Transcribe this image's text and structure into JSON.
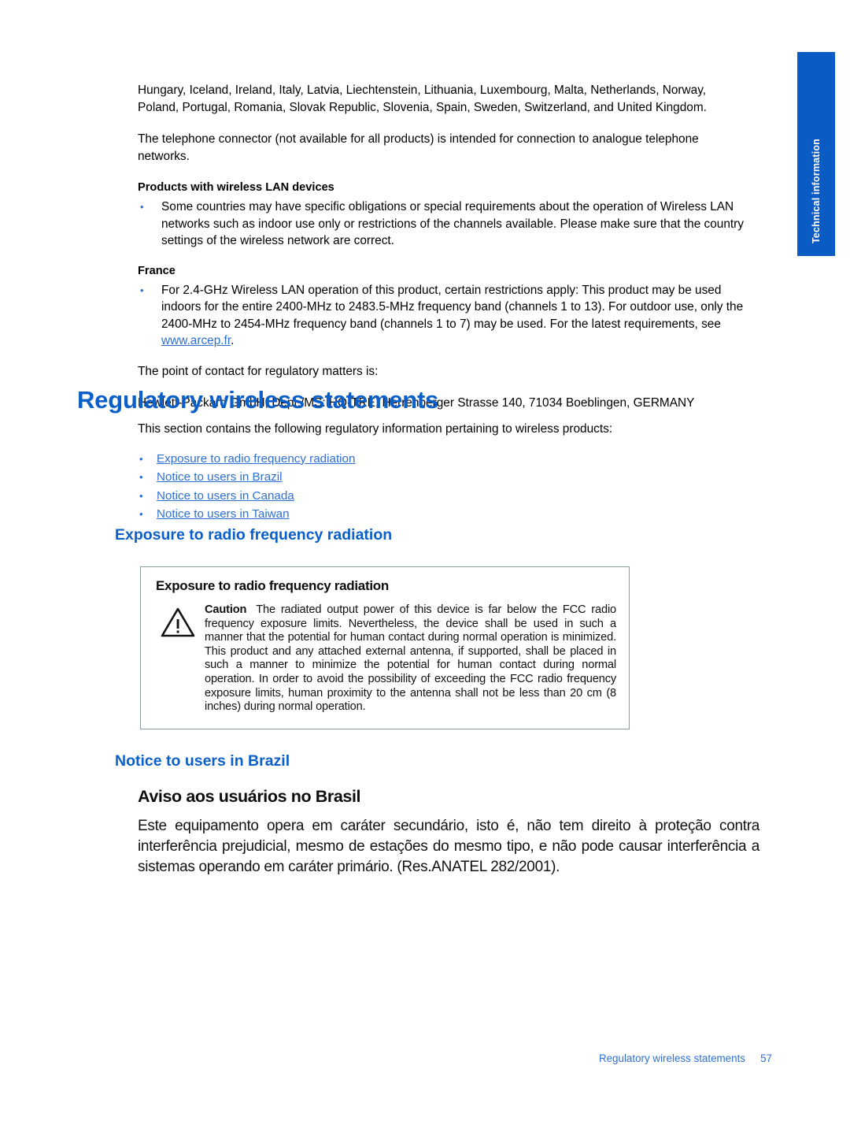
{
  "section_tab": {
    "label": "Technical information",
    "color": "#0A5BC4"
  },
  "colors": {
    "chapter_heading": "#0B5FC9",
    "sub_heading": "#0B5FC9",
    "link": "#2E6FD4",
    "box_border": "#8A9CA5",
    "footer": "#2E6FD4"
  },
  "top_section": {
    "paragraph_countries": "Hungary, Iceland, Ireland, Italy, Latvia, Liechtenstein, Lithuania, Luxembourg, Malta, Netherlands, Norway, Poland, Portugal, Romania, Slovak Republic, Slovenia, Spain, Sweden, Switzerland, and United Kingdom.",
    "paragraph_telephone": "The telephone connector (not available for all products) is intended for connection to analogue telephone networks.",
    "wireless_lan_heading": "Products with wireless LAN devices",
    "wireless_lan_bullet": "Some countries may have specific obligations or special requirements about the operation of Wireless LAN networks such as indoor use only or restrictions of the channels available. Please make sure that the country settings of the wireless network are correct.",
    "france_heading": "France",
    "france_bullet_before_link": "For 2.4-GHz Wireless LAN operation of this product, certain restrictions apply: This product may be used indoors for the entire 2400-MHz to 2483.5-MHz frequency band (channels 1 to 13). For outdoor use, only the 2400-MHz to 2454-MHz frequency band (channels 1 to 7) may be used. For the latest requirements, see ",
    "france_link_text": "www.arcep.fr",
    "france_bullet_after_link": ".",
    "paragraph_contact": "The point of contact for regulatory matters is:",
    "paragraph_address": "Hewlett-Packard GmbH, Dept./MS: HQ-TRE, Herrenberger Strasse 140, 71034 Boeblingen, GERMANY"
  },
  "chapter": {
    "title": "Regulatory wireless statements",
    "intro": "This section contains the following regulatory information pertaining to wireless products:",
    "links": [
      {
        "label": "Exposure to radio frequency radiation"
      },
      {
        "label": "Notice to users in Brazil"
      },
      {
        "label": "Notice to users in Canada"
      },
      {
        "label": "Notice to users in Taiwan"
      }
    ]
  },
  "exposure_section": {
    "heading": "Exposure to radio frequency radiation",
    "graphic": {
      "title": "Exposure to radio frequency radiation",
      "caution_label": "Caution",
      "caution_text": "The radiated output power of this device is far below the FCC radio frequency exposure limits. Nevertheless, the device shall be used in such a manner that the potential for human contact during normal operation is minimized. This product and any attached external antenna, if supported, shall be placed in such a manner to minimize the potential for human contact during normal operation. In order to avoid the possibility of exceeding the FCC radio frequency exposure limits, human proximity to the antenna shall not be less than 20 cm (8 inches) during normal operation.",
      "icon": "warning-triangle-icon"
    }
  },
  "brazil_section": {
    "heading": "Notice to users in Brazil",
    "graphic": {
      "title": "Aviso aos usuários no Brasil",
      "text": "Este equipamento opera em caráter secundário, isto é, não tem direito à proteção contra interferência prejudicial, mesmo de estações do mesmo tipo, e não pode causar interferência a sistemas operando em caráter primário. (Res.ANATEL 282/2001)."
    }
  },
  "footer": {
    "title": "Regulatory wireless statements",
    "page_number": "57"
  }
}
